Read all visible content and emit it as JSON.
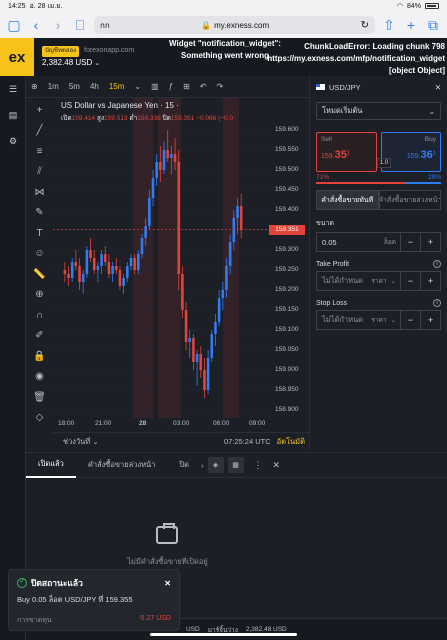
{
  "status": {
    "time": "14:25",
    "date": "อ. 28 เม.ย.",
    "battery": "84%"
  },
  "browser": {
    "tab_text": "กก",
    "url": "my.exness.com"
  },
  "header": {
    "account_type": "บัญชีทดลอง",
    "site": "forexonapp.com",
    "balance": "2,382.48 USD",
    "notification_error": "Widget \"notification_widget\": Something went wrong",
    "chunk_error_line1": "ChunkLoadError: Loading chunk 798",
    "chunk_error_line2": "https://my.exness.com/mfp/notification_widget",
    "chunk_error_line3": "[object Object]"
  },
  "chart_toolbar": {
    "timeframes": [
      "1m",
      "5m",
      "4h",
      "15m"
    ],
    "active": "15m"
  },
  "chart": {
    "title": "US Dollar vs Japanese Yen · 15 ·",
    "ohlc": {
      "open_lbl": "เปิด",
      "open": "159.414",
      "high_lbl": "สูง",
      "high": "159.513",
      "low_lbl": "ต่ำ",
      "low": "159.338",
      "close_lbl": "ปิด",
      "close": "159.351",
      "change": "−0.066 (−0.0"
    },
    "current_price": "159.351",
    "date_range": "ช่วงวันที่",
    "time": "07:25:24 UTC",
    "auto": "อัตโนมัติ"
  },
  "chart_data": {
    "type": "candlestick",
    "ylim": [
      158.9,
      159.65
    ],
    "yticks": [
      "159.600",
      "159.550",
      "159.500",
      "159.450",
      "159.400",
      "159.350",
      "159.300",
      "159.250",
      "159.200",
      "159.150",
      "159.100",
      "159.050",
      "159.000",
      "158.950",
      "158.900"
    ],
    "xticks": [
      "18:00",
      "21:00",
      "28",
      "03:00",
      "06:00",
      "09:00"
    ],
    "candles": [
      [
        159.25,
        159.27,
        159.22,
        159.24
      ],
      [
        159.24,
        159.26,
        159.21,
        159.23
      ],
      [
        159.23,
        159.28,
        159.22,
        159.27
      ],
      [
        159.27,
        159.3,
        159.25,
        159.26
      ],
      [
        159.26,
        159.28,
        159.2,
        159.22
      ],
      [
        159.22,
        159.25,
        159.19,
        159.24
      ],
      [
        159.24,
        159.31,
        159.23,
        159.3
      ],
      [
        159.3,
        159.33,
        159.27,
        159.28
      ],
      [
        159.28,
        159.3,
        159.24,
        159.25
      ],
      [
        159.25,
        159.27,
        159.22,
        159.26
      ],
      [
        159.26,
        159.3,
        159.24,
        159.29
      ],
      [
        159.29,
        159.31,
        159.26,
        159.27
      ],
      [
        159.27,
        159.29,
        159.23,
        159.24
      ],
      [
        159.24,
        159.27,
        159.22,
        159.26
      ],
      [
        159.26,
        159.28,
        159.24,
        159.25
      ],
      [
        159.25,
        159.26,
        159.2,
        159.21
      ],
      [
        159.21,
        159.24,
        159.19,
        159.23
      ],
      [
        159.23,
        159.27,
        159.22,
        159.26
      ],
      [
        159.26,
        159.29,
        159.25,
        159.28
      ],
      [
        159.28,
        159.29,
        159.24,
        159.25
      ],
      [
        159.25,
        159.3,
        159.24,
        159.29
      ],
      [
        159.29,
        159.34,
        159.28,
        159.33
      ],
      [
        159.33,
        159.38,
        159.31,
        159.36
      ],
      [
        159.36,
        159.45,
        159.35,
        159.43
      ],
      [
        159.43,
        159.5,
        159.41,
        159.48
      ],
      [
        159.48,
        159.54,
        159.46,
        159.52
      ],
      [
        159.52,
        159.56,
        159.47,
        159.5
      ],
      [
        159.5,
        159.57,
        159.49,
        159.55
      ],
      [
        159.55,
        159.6,
        159.52,
        159.53
      ],
      [
        159.53,
        159.56,
        159.49,
        159.54
      ],
      [
        159.54,
        159.58,
        159.5,
        159.52
      ],
      [
        159.52,
        159.55,
        159.2,
        159.24
      ],
      [
        159.24,
        159.26,
        159.13,
        159.15
      ],
      [
        159.15,
        159.17,
        159.05,
        159.07
      ],
      [
        159.07,
        159.1,
        159.03,
        159.08
      ],
      [
        159.08,
        159.09,
        159.0,
        159.02
      ],
      [
        159.02,
        159.05,
        158.96,
        159.04
      ],
      [
        159.04,
        159.06,
        158.98,
        159.0
      ],
      [
        159.0,
        159.03,
        158.93,
        158.95
      ],
      [
        158.95,
        159.05,
        158.94,
        159.03
      ],
      [
        159.03,
        159.1,
        159.02,
        159.09
      ],
      [
        159.09,
        159.14,
        159.06,
        159.12
      ],
      [
        159.12,
        159.2,
        159.11,
        159.18
      ],
      [
        159.18,
        159.22,
        159.15,
        159.2
      ],
      [
        159.2,
        159.28,
        159.18,
        159.26
      ],
      [
        159.26,
        159.34,
        159.24,
        159.32
      ],
      [
        159.32,
        159.4,
        159.3,
        159.38
      ],
      [
        159.38,
        159.43,
        159.34,
        159.41
      ],
      [
        159.41,
        159.44,
        159.33,
        159.35
      ]
    ]
  },
  "panel": {
    "symbol": "USD/JPY",
    "mode": "โหมดเริ่มต้น",
    "sell_label": "Sell",
    "buy_label": "Buy",
    "sell_price_prefix": "159.",
    "sell_price_big": "35",
    "sell_price_sup": "1",
    "buy_price_prefix": "159.",
    "buy_price_big": "36",
    "buy_price_sup": "1",
    "spread": "1.0",
    "sell_pct": "71%",
    "buy_pct": "29%",
    "order_instant": "คำสั่งซื้อขายทันที",
    "order_pending": "คำสั่งซื้อขายล่วงหน้า",
    "volume_label": "ขนาด",
    "volume": "0.05",
    "volume_unit": "ล็อต",
    "tp_label": "Take Profit",
    "sl_label": "Stop Loss",
    "not_set": "ไม่ได้กำหนด",
    "price_unit": "ราคา"
  },
  "positions": {
    "tab_open": "เปิดแล้ว",
    "tab_pending": "คำสั่งซื้อขายล่วงหน้า",
    "tab_closed": "ปิด",
    "empty_text": "ไม่มีคำสั่งซื้อขายที่เปิดอยู่"
  },
  "toast": {
    "title": "ปิดสถานะแล้ว",
    "body": "Buy 0.05 ล็อต USD/JPY ที่ 159.355",
    "pl_label": "การขาดทุน",
    "pl_value": "-5.27 USD"
  },
  "footer": {
    "text1": "USD",
    "text2": "มาร์จิ้นว่าง",
    "text3": "2,382.48 USD"
  }
}
